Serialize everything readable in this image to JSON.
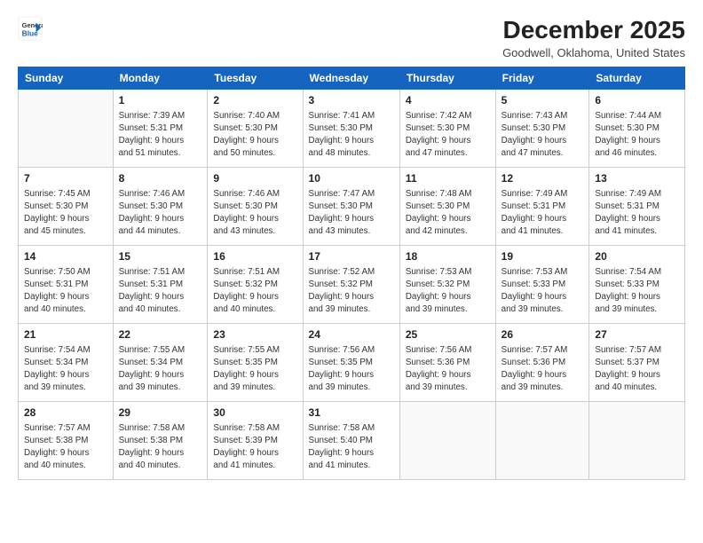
{
  "header": {
    "logo_line1": "General",
    "logo_line2": "Blue",
    "month_title": "December 2025",
    "location": "Goodwell, Oklahoma, United States"
  },
  "days_of_week": [
    "Sunday",
    "Monday",
    "Tuesday",
    "Wednesday",
    "Thursday",
    "Friday",
    "Saturday"
  ],
  "weeks": [
    [
      {
        "day": "",
        "info": ""
      },
      {
        "day": "1",
        "info": "Sunrise: 7:39 AM\nSunset: 5:31 PM\nDaylight: 9 hours\nand 51 minutes."
      },
      {
        "day": "2",
        "info": "Sunrise: 7:40 AM\nSunset: 5:30 PM\nDaylight: 9 hours\nand 50 minutes."
      },
      {
        "day": "3",
        "info": "Sunrise: 7:41 AM\nSunset: 5:30 PM\nDaylight: 9 hours\nand 48 minutes."
      },
      {
        "day": "4",
        "info": "Sunrise: 7:42 AM\nSunset: 5:30 PM\nDaylight: 9 hours\nand 47 minutes."
      },
      {
        "day": "5",
        "info": "Sunrise: 7:43 AM\nSunset: 5:30 PM\nDaylight: 9 hours\nand 47 minutes."
      },
      {
        "day": "6",
        "info": "Sunrise: 7:44 AM\nSunset: 5:30 PM\nDaylight: 9 hours\nand 46 minutes."
      }
    ],
    [
      {
        "day": "7",
        "info": "Sunrise: 7:45 AM\nSunset: 5:30 PM\nDaylight: 9 hours\nand 45 minutes."
      },
      {
        "day": "8",
        "info": "Sunrise: 7:46 AM\nSunset: 5:30 PM\nDaylight: 9 hours\nand 44 minutes."
      },
      {
        "day": "9",
        "info": "Sunrise: 7:46 AM\nSunset: 5:30 PM\nDaylight: 9 hours\nand 43 minutes."
      },
      {
        "day": "10",
        "info": "Sunrise: 7:47 AM\nSunset: 5:30 PM\nDaylight: 9 hours\nand 43 minutes."
      },
      {
        "day": "11",
        "info": "Sunrise: 7:48 AM\nSunset: 5:30 PM\nDaylight: 9 hours\nand 42 minutes."
      },
      {
        "day": "12",
        "info": "Sunrise: 7:49 AM\nSunset: 5:31 PM\nDaylight: 9 hours\nand 41 minutes."
      },
      {
        "day": "13",
        "info": "Sunrise: 7:49 AM\nSunset: 5:31 PM\nDaylight: 9 hours\nand 41 minutes."
      }
    ],
    [
      {
        "day": "14",
        "info": "Sunrise: 7:50 AM\nSunset: 5:31 PM\nDaylight: 9 hours\nand 40 minutes."
      },
      {
        "day": "15",
        "info": "Sunrise: 7:51 AM\nSunset: 5:31 PM\nDaylight: 9 hours\nand 40 minutes."
      },
      {
        "day": "16",
        "info": "Sunrise: 7:51 AM\nSunset: 5:32 PM\nDaylight: 9 hours\nand 40 minutes."
      },
      {
        "day": "17",
        "info": "Sunrise: 7:52 AM\nSunset: 5:32 PM\nDaylight: 9 hours\nand 39 minutes."
      },
      {
        "day": "18",
        "info": "Sunrise: 7:53 AM\nSunset: 5:32 PM\nDaylight: 9 hours\nand 39 minutes."
      },
      {
        "day": "19",
        "info": "Sunrise: 7:53 AM\nSunset: 5:33 PM\nDaylight: 9 hours\nand 39 minutes."
      },
      {
        "day": "20",
        "info": "Sunrise: 7:54 AM\nSunset: 5:33 PM\nDaylight: 9 hours\nand 39 minutes."
      }
    ],
    [
      {
        "day": "21",
        "info": "Sunrise: 7:54 AM\nSunset: 5:34 PM\nDaylight: 9 hours\nand 39 minutes."
      },
      {
        "day": "22",
        "info": "Sunrise: 7:55 AM\nSunset: 5:34 PM\nDaylight: 9 hours\nand 39 minutes."
      },
      {
        "day": "23",
        "info": "Sunrise: 7:55 AM\nSunset: 5:35 PM\nDaylight: 9 hours\nand 39 minutes."
      },
      {
        "day": "24",
        "info": "Sunrise: 7:56 AM\nSunset: 5:35 PM\nDaylight: 9 hours\nand 39 minutes."
      },
      {
        "day": "25",
        "info": "Sunrise: 7:56 AM\nSunset: 5:36 PM\nDaylight: 9 hours\nand 39 minutes."
      },
      {
        "day": "26",
        "info": "Sunrise: 7:57 AM\nSunset: 5:36 PM\nDaylight: 9 hours\nand 39 minutes."
      },
      {
        "day": "27",
        "info": "Sunrise: 7:57 AM\nSunset: 5:37 PM\nDaylight: 9 hours\nand 40 minutes."
      }
    ],
    [
      {
        "day": "28",
        "info": "Sunrise: 7:57 AM\nSunset: 5:38 PM\nDaylight: 9 hours\nand 40 minutes."
      },
      {
        "day": "29",
        "info": "Sunrise: 7:58 AM\nSunset: 5:38 PM\nDaylight: 9 hours\nand 40 minutes."
      },
      {
        "day": "30",
        "info": "Sunrise: 7:58 AM\nSunset: 5:39 PM\nDaylight: 9 hours\nand 41 minutes."
      },
      {
        "day": "31",
        "info": "Sunrise: 7:58 AM\nSunset: 5:40 PM\nDaylight: 9 hours\nand 41 minutes."
      },
      {
        "day": "",
        "info": ""
      },
      {
        "day": "",
        "info": ""
      },
      {
        "day": "",
        "info": ""
      }
    ]
  ]
}
